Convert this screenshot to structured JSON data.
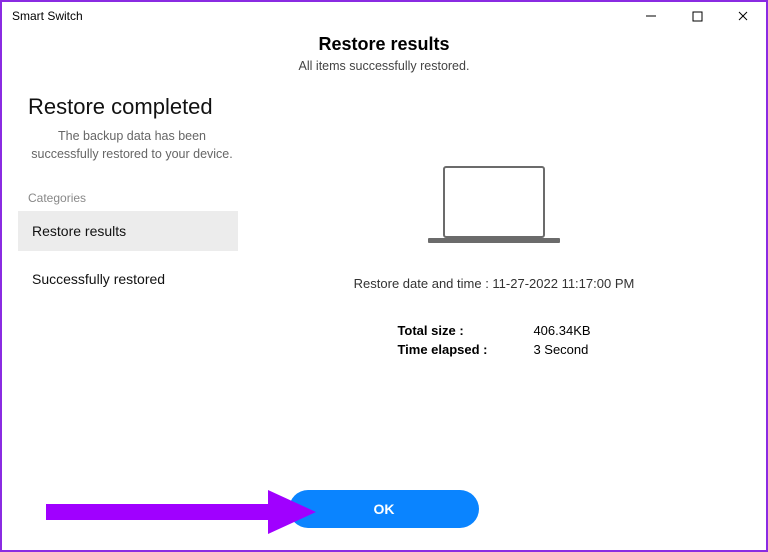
{
  "window": {
    "title": "Smart Switch"
  },
  "header": {
    "title": "Restore results",
    "subtitle": "All items successfully restored."
  },
  "left": {
    "heading": "Restore completed",
    "description": "The backup data has been successfully restored to your device.",
    "categories_label": "Categories",
    "items": [
      {
        "label": "Restore results"
      },
      {
        "label": "Successfully restored"
      }
    ]
  },
  "main": {
    "restore_line_prefix": "Restore date and time : ",
    "restore_datetime": "11-27-2022 11:17:00 PM",
    "stats": {
      "total_size_label": "Total size :",
      "total_size_value": "406.34KB",
      "time_elapsed_label": "Time elapsed :",
      "time_elapsed_value": "3 Second"
    }
  },
  "footer": {
    "ok_label": "OK"
  },
  "colors": {
    "accent": "#0a84ff",
    "border": "#8a2be2",
    "annotation": "#a000ff"
  }
}
